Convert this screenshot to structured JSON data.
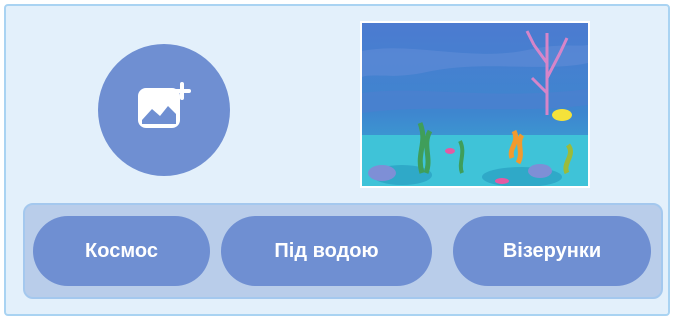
{
  "backdrop_picker": {
    "add_button": {
      "icon": "add-image-icon"
    },
    "thumbnail": {
      "icon": "underwater-backdrop"
    },
    "tags": [
      {
        "label": "Космос"
      },
      {
        "label": "Під водою"
      },
      {
        "label": "Візерунки"
      }
    ],
    "colors": {
      "panel_bg": "#e3f0fb",
      "accent": "#6f8fd2",
      "tag_bar_bg": "#b9cdea"
    }
  }
}
